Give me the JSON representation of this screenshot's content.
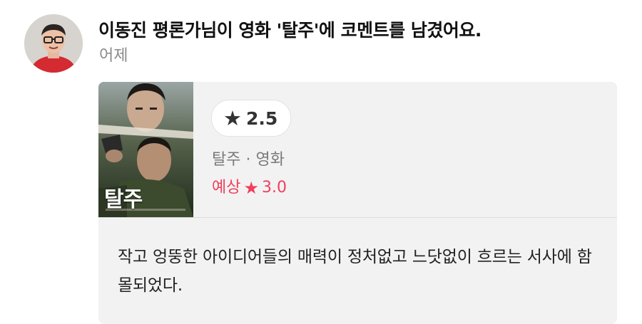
{
  "activity": {
    "headline": "이동진 평론가님이 영화 '탈주'에 코멘트를 남겼어요.",
    "timestamp": "어제"
  },
  "movie": {
    "poster_title": "탈주",
    "rating": "2.5",
    "meta": "탈주 · 영화",
    "expected_label": "예상",
    "expected_rating": "3.0"
  },
  "comment": {
    "text": "작고 엉뚱한 아이디어들의 매력이 정처없고 느닷없이 흐르는 서사에 함몰되었다."
  },
  "icons": {
    "rating_star": "star-icon",
    "expected_star": "star-icon"
  },
  "colors": {
    "expected_accent": "#f0405d",
    "card_background": "#f2f2f2",
    "timestamp_gray": "#8a8a8a"
  }
}
